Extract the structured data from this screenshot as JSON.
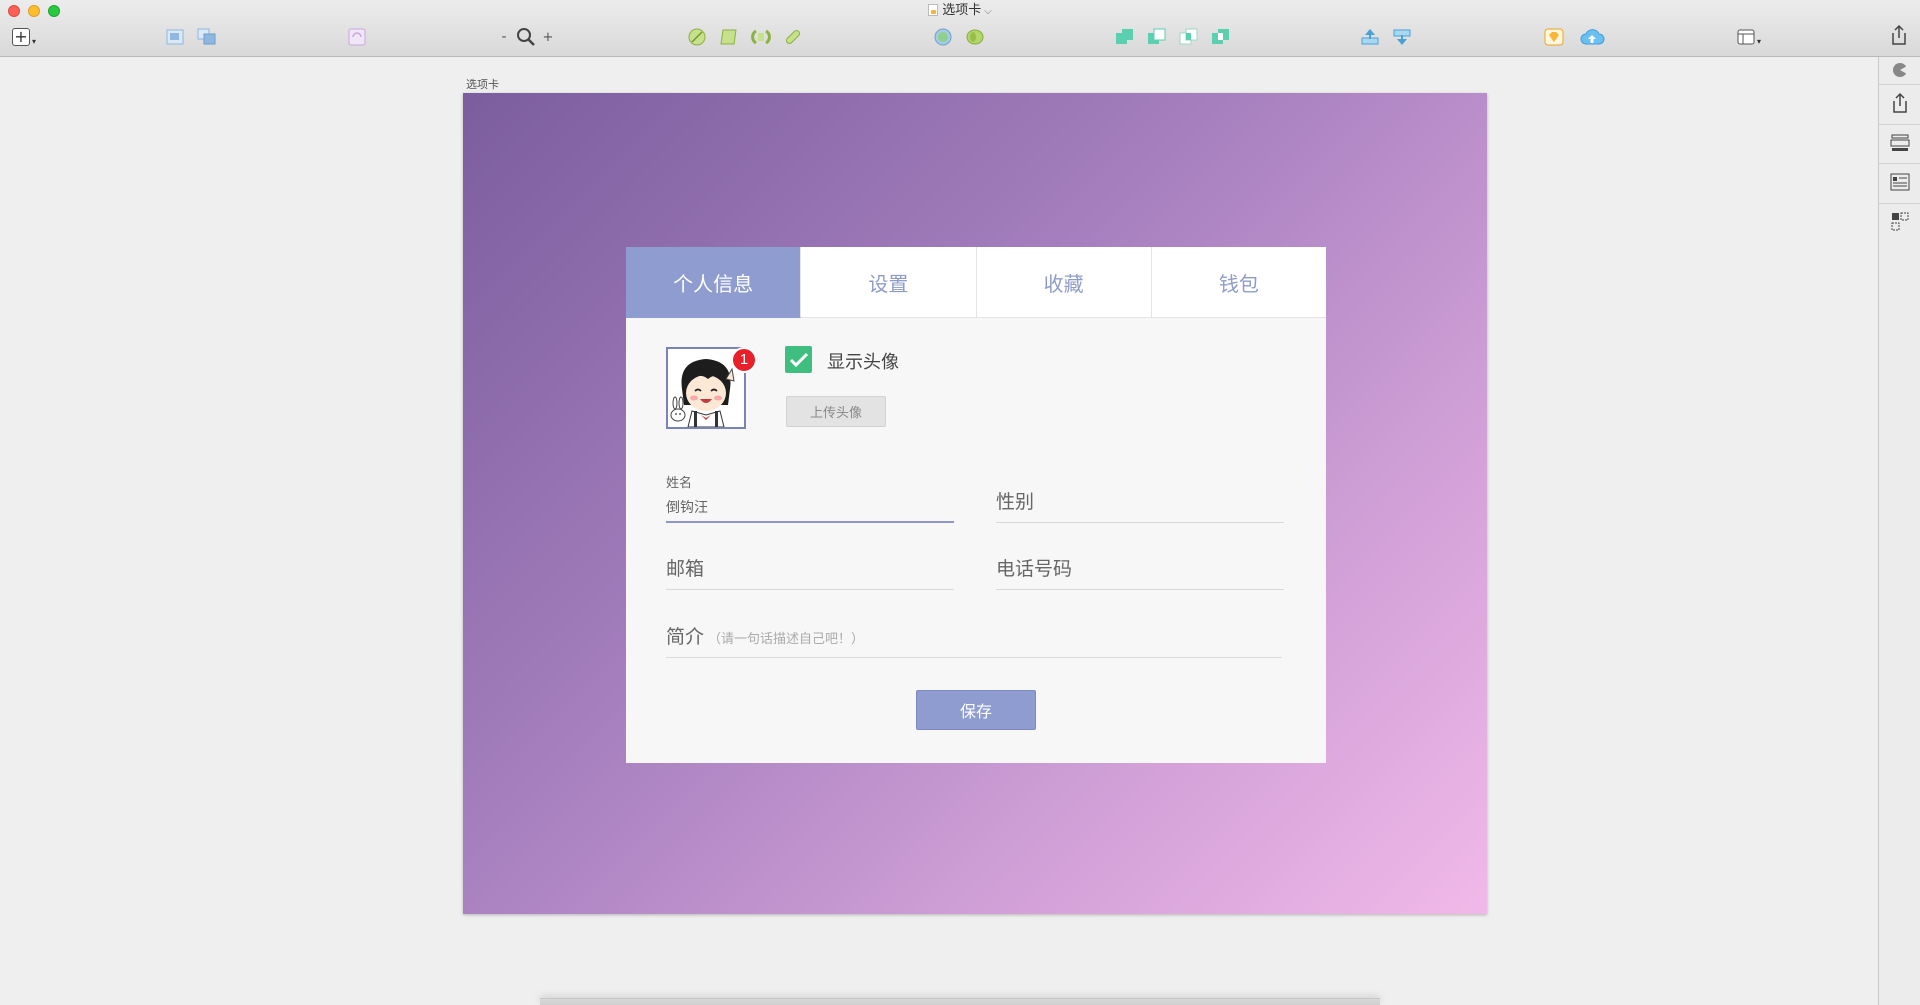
{
  "window": {
    "title": "选项卡"
  },
  "toolbar": {
    "insert_icon": "plus-icon",
    "zoom_minus": "-",
    "zoom_plus": "+",
    "colors": {
      "group": "#8fb7e0",
      "rotate": "#c9a5e0",
      "bool": "#a8cc5a",
      "arrange": "#5ccfb0",
      "forward": "#4aa0d8",
      "mirror": "#a8d8f0",
      "sketch": "#f7b53a",
      "cloud": "#3b9fe0"
    }
  },
  "canvas": {
    "artboard_label": "选项卡"
  },
  "card": {
    "tabs": [
      {
        "label": "个人信息",
        "active": true
      },
      {
        "label": "设置",
        "active": false
      },
      {
        "label": "收藏",
        "active": false
      },
      {
        "label": "钱包",
        "active": false
      }
    ],
    "avatar": {
      "badge": "1"
    },
    "show_avatar": {
      "label": "显示头像",
      "checked": true
    },
    "upload_label": "上传头像",
    "fields": {
      "name": {
        "label": "姓名",
        "value": "倒钩汪"
      },
      "gender": {
        "label": "性别"
      },
      "email": {
        "label": "邮箱"
      },
      "phone": {
        "label": "电话号码"
      },
      "bio": {
        "label": "简介",
        "hint": "（请一句话描述自己吧！）"
      }
    },
    "save_label": "保存"
  },
  "colors": {
    "accent": "#8f9cd0",
    "check": "#3fbf7f",
    "badge": "#e8202a"
  }
}
